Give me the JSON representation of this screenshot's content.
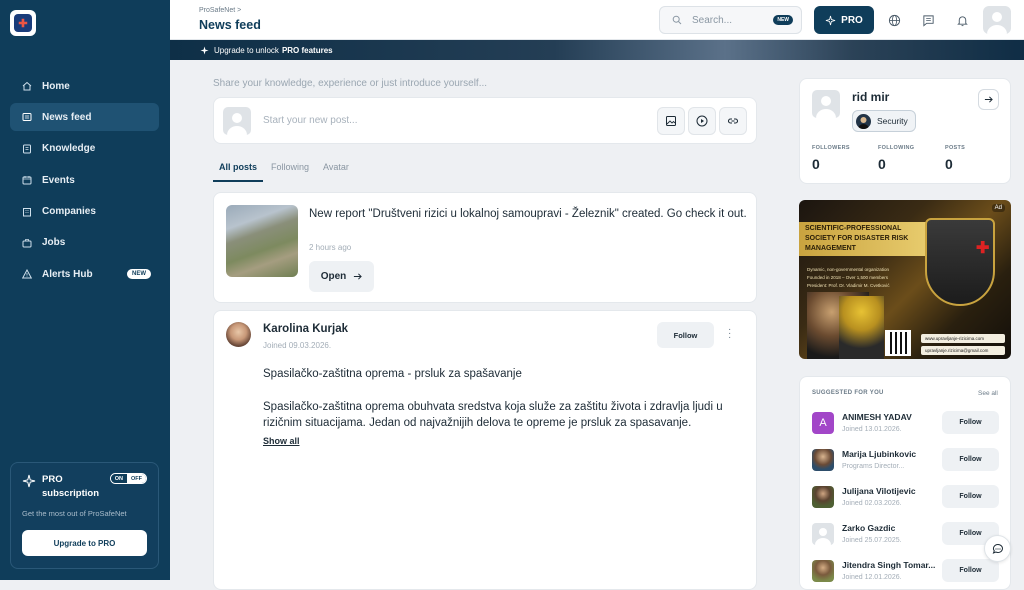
{
  "sidebar": {
    "logo_icon": "prosafenet-logo",
    "items": [
      {
        "label": "Home",
        "icon": "home-icon"
      },
      {
        "label": "News feed",
        "icon": "newspaper-icon",
        "active": true
      },
      {
        "label": "Knowledge",
        "icon": "book-icon"
      },
      {
        "label": "Events",
        "icon": "calendar-icon"
      },
      {
        "label": "Companies",
        "icon": "building-icon"
      },
      {
        "label": "Jobs",
        "icon": "briefcase-icon"
      },
      {
        "label": "Alerts Hub",
        "icon": "alert-icon",
        "badge": "NEW"
      }
    ],
    "pro": {
      "title": "PRO subscription",
      "toggle_on": "ON",
      "toggle_off": "OFF",
      "subtitle": "Get the most out of ProSafeNet",
      "button": "Upgrade to PRO"
    }
  },
  "header": {
    "breadcrumb": "ProSafeNet >",
    "title": "News feed",
    "search_placeholder": "Search...",
    "search_badge": "NEW",
    "pro_button": "PRO"
  },
  "banner": {
    "text": "Upgrade to unlock",
    "bold": "PRO features"
  },
  "composer": {
    "prompt": "Share your knowledge, experience or just introduce yourself...",
    "placeholder": "Start your new post..."
  },
  "tabs": [
    {
      "label": "All posts",
      "active": true
    },
    {
      "label": "Following"
    },
    {
      "label": "Avatar"
    }
  ],
  "posts": [
    {
      "title": "New report \"Društveni rizici u lokalnoj samoupravi - Železnik\" created. Go check it out.",
      "time": "2 hours ago",
      "action": "Open"
    },
    {
      "author": "Karolina Kurjak",
      "joined": "Joined 09.03.2026.",
      "follow": "Follow",
      "title": "Spasilačko-zaštitna oprema - prsluk za spašavanje",
      "body": "Spasilačko-zaštitna oprema obuhvata sredstva koja služe za zaštitu života i zdravlja ljudi u rizičnim situacijama. Jedan od najvažnijih delova te opreme je prsluk za spasavanje.",
      "more": "Show all"
    }
  ],
  "profile": {
    "name": "rid mir",
    "role": "Security",
    "stats": [
      {
        "label": "FOLLOWERS",
        "value": "0"
      },
      {
        "label": "FOLLOWING",
        "value": "0"
      },
      {
        "label": "POSTS",
        "value": "0"
      }
    ]
  },
  "ad": {
    "tag": "Ad",
    "title": "SCIENTIFIC-PROFESSIONAL SOCIETY FOR DISASTER RISK MANAGEMENT",
    "bullets": [
      "Dynamic, non-governmental organization",
      "Founded in 2018 – Over 1,500 members",
      "President: Prof. Dr. Vladimir M. Cvetković"
    ],
    "url1": "www.upravljanje-rizicima.com",
    "url2": "upravljanje.rizicima@gmail.com"
  },
  "suggested": {
    "heading": "SUGGESTED FOR YOU",
    "see_all": "See all",
    "items": [
      {
        "initial": "A",
        "name": "ANIMESH YADAV",
        "sub": "Joined 13.01.2026.",
        "follow": "Follow",
        "color": "#a246c8"
      },
      {
        "initial": "",
        "name": "Marija Ljubinkovic",
        "sub": "Programs Director...",
        "follow": "Follow",
        "color": "#3b5670"
      },
      {
        "initial": "",
        "name": "Julijana Vilotijevic",
        "sub": "Joined 02.03.2026.",
        "follow": "Follow",
        "color": "#5e6a3e"
      },
      {
        "initial": "",
        "name": "Zarko Gazdic",
        "sub": "Joined 25.07.2025.",
        "follow": "Follow",
        "color": "#dfe3e7"
      },
      {
        "initial": "",
        "name": "Jitendra Singh Tomar...",
        "sub": "Joined 12.01.2026.",
        "follow": "Follow",
        "color": "#7b8a4a"
      }
    ]
  },
  "colors": {
    "sidebar": "#0f3d5a",
    "accent": "#0f3d5a",
    "background": "#eef0f3"
  }
}
